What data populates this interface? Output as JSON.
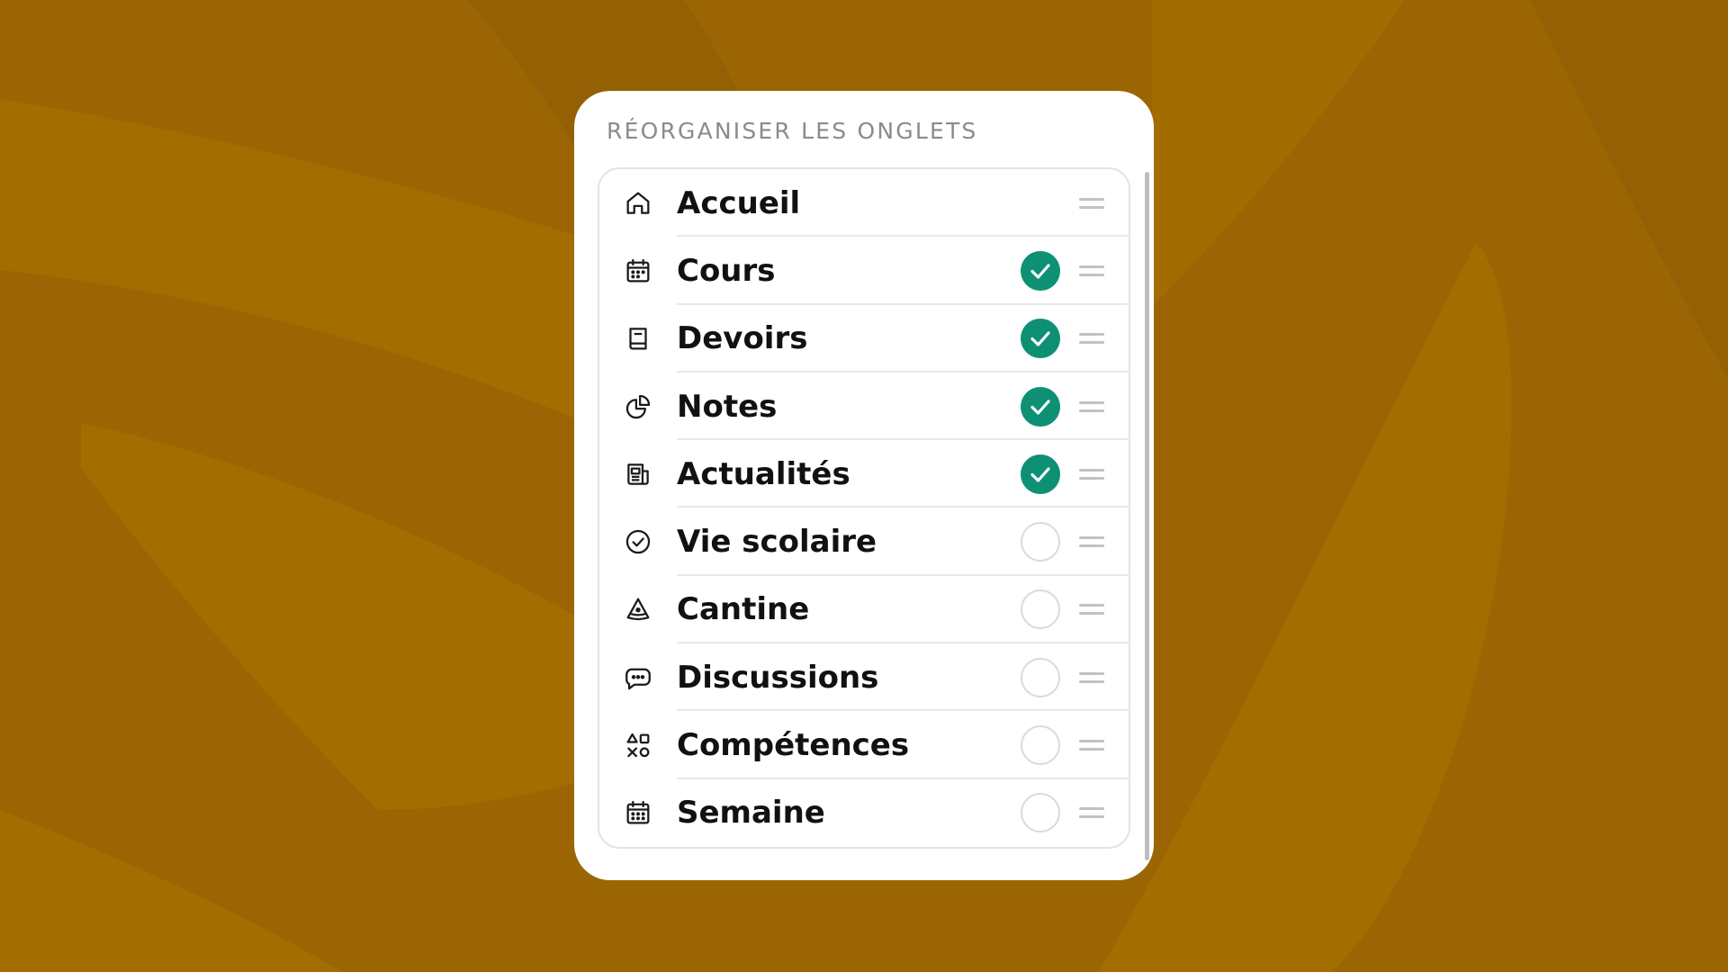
{
  "panel": {
    "title": "RÉORGANISER LES ONGLETS"
  },
  "tabs": [
    {
      "label": "Accueil",
      "icon": "home-icon",
      "toggle": null
    },
    {
      "label": "Cours",
      "icon": "calendar-icon",
      "toggle": true
    },
    {
      "label": "Devoirs",
      "icon": "book-icon",
      "toggle": true
    },
    {
      "label": "Notes",
      "icon": "pie-chart-icon",
      "toggle": true
    },
    {
      "label": "Actualités",
      "icon": "newspaper-icon",
      "toggle": true
    },
    {
      "label": "Vie scolaire",
      "icon": "check-circle-icon",
      "toggle": false
    },
    {
      "label": "Cantine",
      "icon": "pizza-slice-icon",
      "toggle": false
    },
    {
      "label": "Discussions",
      "icon": "chat-bubble-icon",
      "toggle": false
    },
    {
      "label": "Compétences",
      "icon": "shapes-icon",
      "toggle": false
    },
    {
      "label": "Semaine",
      "icon": "calendar-week-icon",
      "toggle": false
    }
  ],
  "colors": {
    "background": "#9C6504",
    "accent_checked": "#0E9075",
    "card": "#FFFFFF"
  }
}
